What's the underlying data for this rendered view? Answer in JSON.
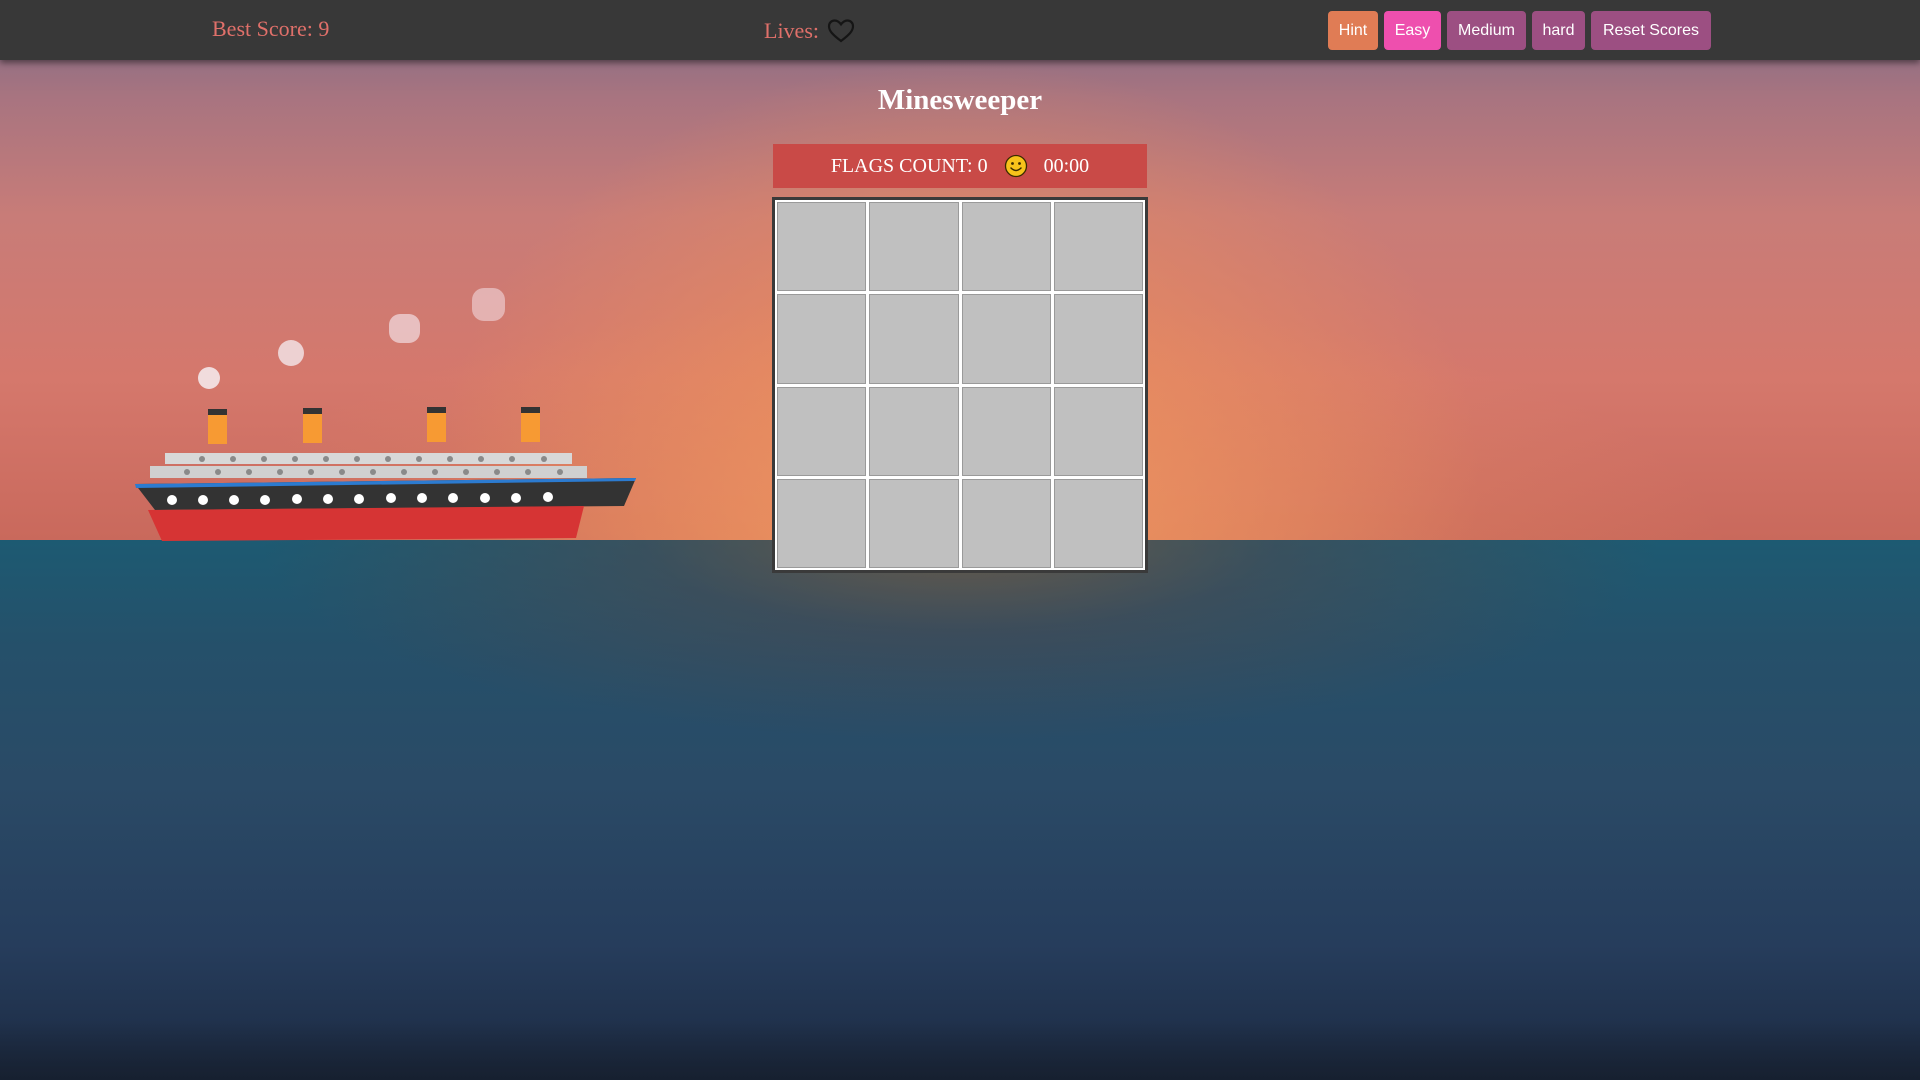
{
  "topbar": {
    "best_score_label": "Best Score: 9",
    "lives_label": "Lives:",
    "lives_icon": "heart-icon",
    "buttons": {
      "hint": "Hint",
      "easy": "Easy",
      "medium": "Medium",
      "hard": "hard",
      "reset": "Reset Scores"
    }
  },
  "game": {
    "title": "Minesweeper",
    "flags_label": "FLAGS COUNT: 0",
    "status_icon": "smiley-icon",
    "timer": "00:00",
    "rows": 4,
    "cols": 4
  },
  "colors": {
    "topbar_bg": "#383838",
    "score_text": "#e0706a",
    "hint_button": "#e07c55",
    "easy_button": "#ee4fae",
    "difficulty_button": "#9c4f82",
    "status_bar": "#c94a47",
    "cell": "#c0c0c0"
  }
}
